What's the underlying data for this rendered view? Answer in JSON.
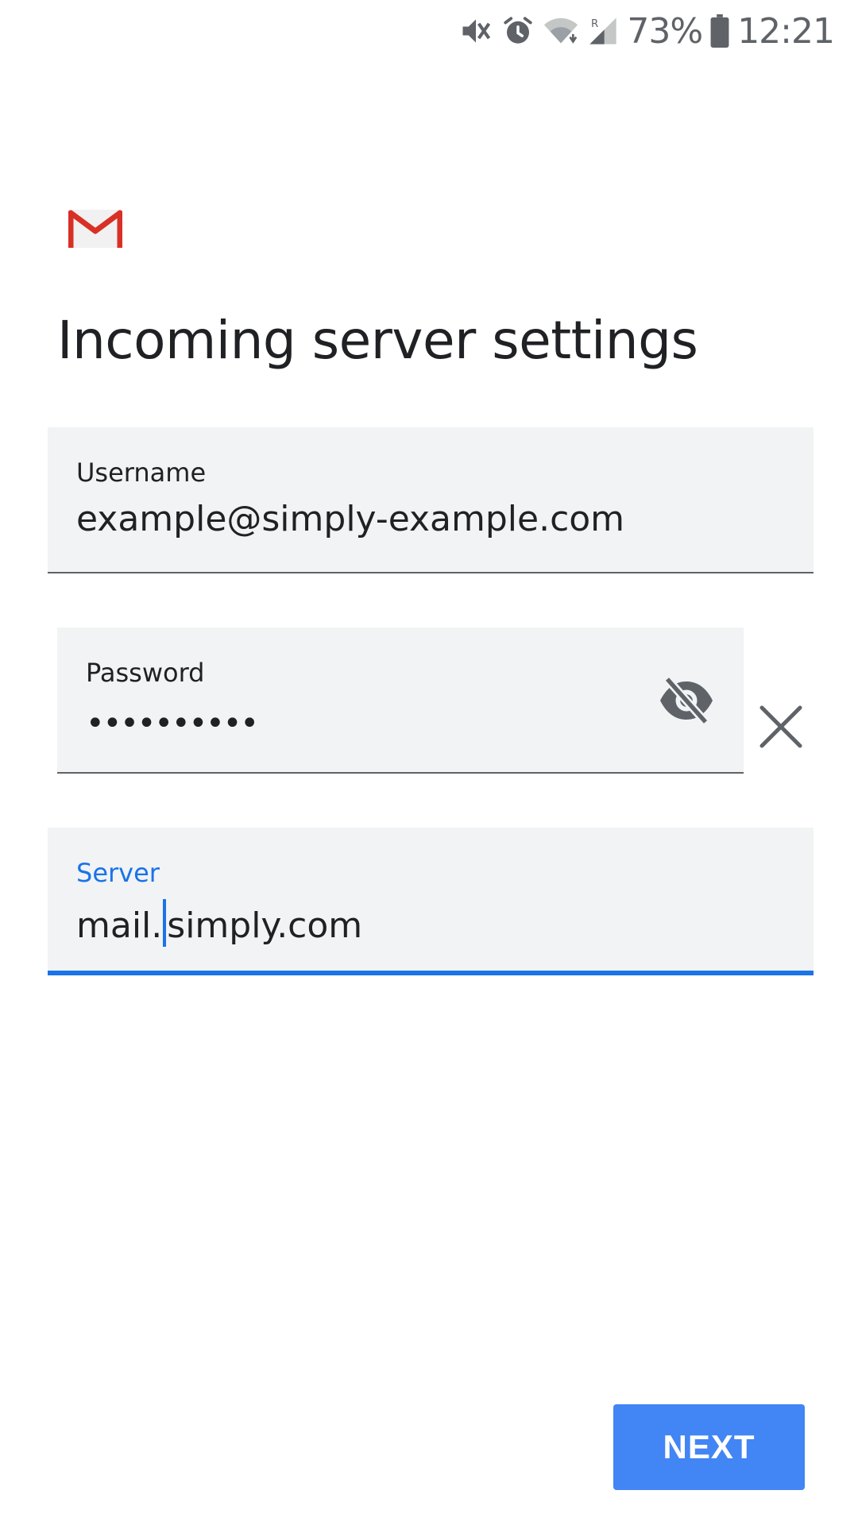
{
  "status_bar": {
    "battery_percent": "73%",
    "time": "12:21",
    "icons": [
      "mute-icon",
      "alarm-icon",
      "wifi-icon",
      "signal-icon",
      "battery-icon"
    ]
  },
  "logo": {
    "icon": "gmail-icon"
  },
  "page_title": "Incoming server settings",
  "fields": {
    "username": {
      "label": "Username",
      "value": "example@simply-example.com"
    },
    "password": {
      "label": "Password",
      "value": "••••••••••",
      "toggle_icon": "visibility-off-icon",
      "clear_icon": "close-icon"
    },
    "server": {
      "label": "Server",
      "value_before_cursor": "mail.",
      "value_after_cursor": "simply.com"
    }
  },
  "actions": {
    "next_label": "NEXT"
  },
  "colors": {
    "accent": "#1a73e8",
    "button": "#4285f4",
    "field_background": "#f1f3f4",
    "gmail_red": "#d93025"
  }
}
